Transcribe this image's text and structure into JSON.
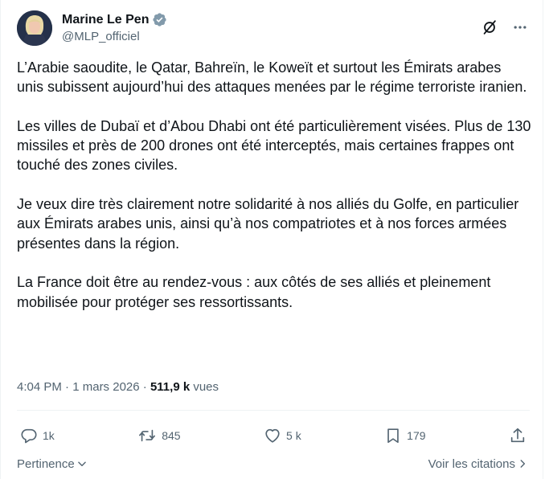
{
  "author": {
    "display_name": "Marine Le Pen",
    "handle": "@MLP_officiel",
    "verified_color": "#829aab"
  },
  "icons": {
    "verified": "verified-badge-icon",
    "grok": "grok-icon",
    "more": "more-icon",
    "reply": "reply-icon",
    "repost": "repost-icon",
    "like": "like-icon",
    "bookmark": "bookmark-icon",
    "share": "share-icon"
  },
  "tweet": {
    "paragraphs": [
      "L’Arabie saoudite, le Qatar, Bahreïn, le Koweït et surtout les Émirats arabes unis subissent aujourd’hui des attaques menées par le régime terroriste iranien.",
      "Les villes de Dubaï et d’Abou Dhabi ont été particulièrement visées. Plus de 130 missiles et près de 200 drones ont été interceptés, mais certaines frappes ont touché des zones civiles.",
      "Je veux dire très clairement notre solidarité à nos alliés du Golfe, en particulier aux Émirats arabes unis, ainsi qu’à nos compatriotes et à nos forces armées présentes dans la région.",
      "La France doit être au rendez-vous : aux côtés de ses alliés et pleinement mobilisée pour protéger ses ressortissants."
    ]
  },
  "meta": {
    "time": "4:04 PM",
    "separator": " · ",
    "date": "1 mars 2026",
    "views_count": "511,9 k",
    "views_label": " vues"
  },
  "actions": {
    "replies": "1k",
    "reposts": "845",
    "likes": "5 k",
    "bookmarks": "179"
  },
  "footer": {
    "sort_label": "Pertinence",
    "quotes_label": "Voir les citations"
  },
  "colors": {
    "text": "#0f1419",
    "secondary": "#536471",
    "divider": "#eff3f4"
  }
}
